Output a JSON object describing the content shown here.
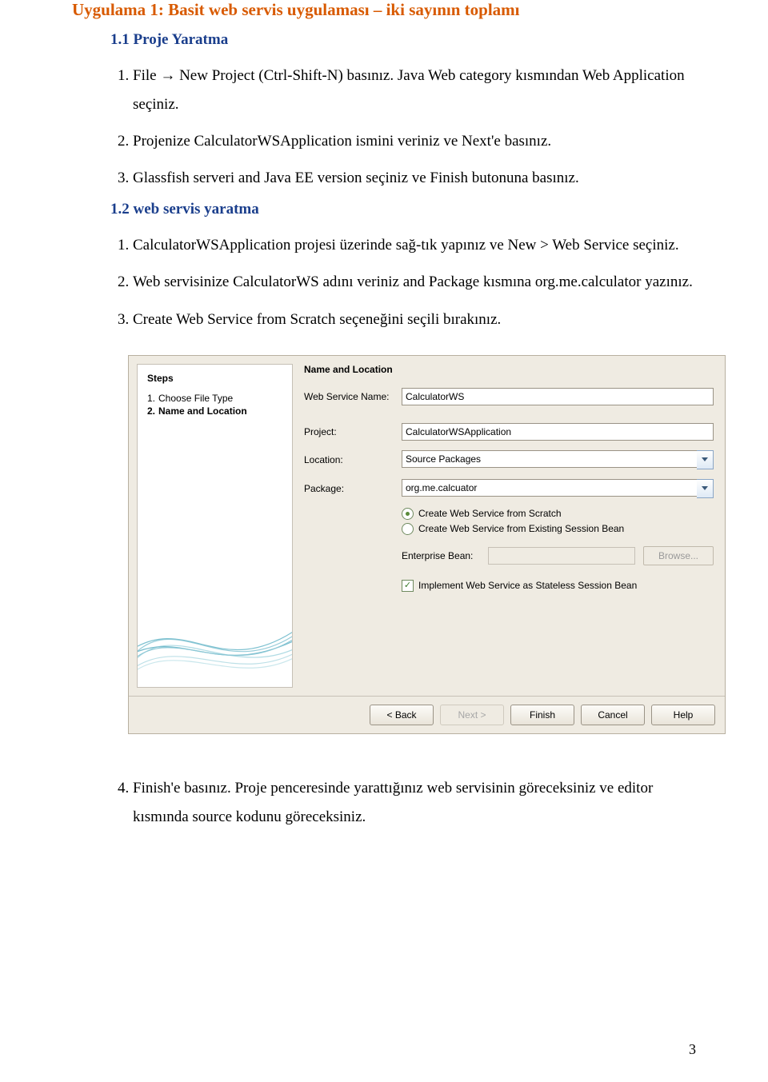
{
  "doc": {
    "title": "Uygulama 1: Basit web servis uygulaması – iki sayının toplamı",
    "section1": "1.1 Proje Yaratma",
    "list1": {
      "item1_a": "File ",
      "item1_arrow": "→",
      "item1_b": " New Project (Ctrl-Shift-N) basınız. Java Web category kısmından Web Application seçiniz.",
      "item2": "Projenize CalculatorWSApplication ismini veriniz ve Next'e basınız.",
      "item3": "Glassfish serveri and Java EE version seçiniz ve Finish butonuna basınız."
    },
    "section2": "1.2 web servis yaratma",
    "list2": {
      "item1": "CalculatorWSApplication projesi üzerinde sağ-tık yapınız ve New > Web Service seçiniz.",
      "item2_a": "Web servisinize CalculatorWS adını veriniz and Package kısmına ",
      "item2_b": "org.me.calculator",
      "item2_c": " yazınız.",
      "item3": "Create Web Service from Scratch seçeneğini seçili bırakınız."
    },
    "post": {
      "item4": "Finish'e basınız. Proje penceresinde yarattığınız web servisinin göreceksiniz ve editor kısmında source kodunu göreceksiniz."
    },
    "page_number": "3"
  },
  "wizard": {
    "steps_title": "Steps",
    "steps": [
      {
        "n": "1.",
        "label": "Choose File Type"
      },
      {
        "n": "2.",
        "label": "Name and Location"
      }
    ],
    "form_title": "Name and Location",
    "labels": {
      "web_service_name": "Web Service Name:",
      "project": "Project:",
      "location": "Location:",
      "package": "Package:",
      "enterprise_bean": "Enterprise Bean:"
    },
    "values": {
      "web_service_name": "CalculatorWS",
      "project": "CalculatorWSApplication",
      "location": "Source Packages",
      "package": "org.me.calcuator"
    },
    "radios": {
      "scratch": "Create Web Service from Scratch",
      "existing": "Create Web Service from Existing Session Bean"
    },
    "browse": "Browse...",
    "implement": "Implement Web Service as Stateless Session Bean",
    "buttons": {
      "back": "< Back",
      "next": "Next >",
      "finish": "Finish",
      "cancel": "Cancel",
      "help": "Help"
    }
  }
}
